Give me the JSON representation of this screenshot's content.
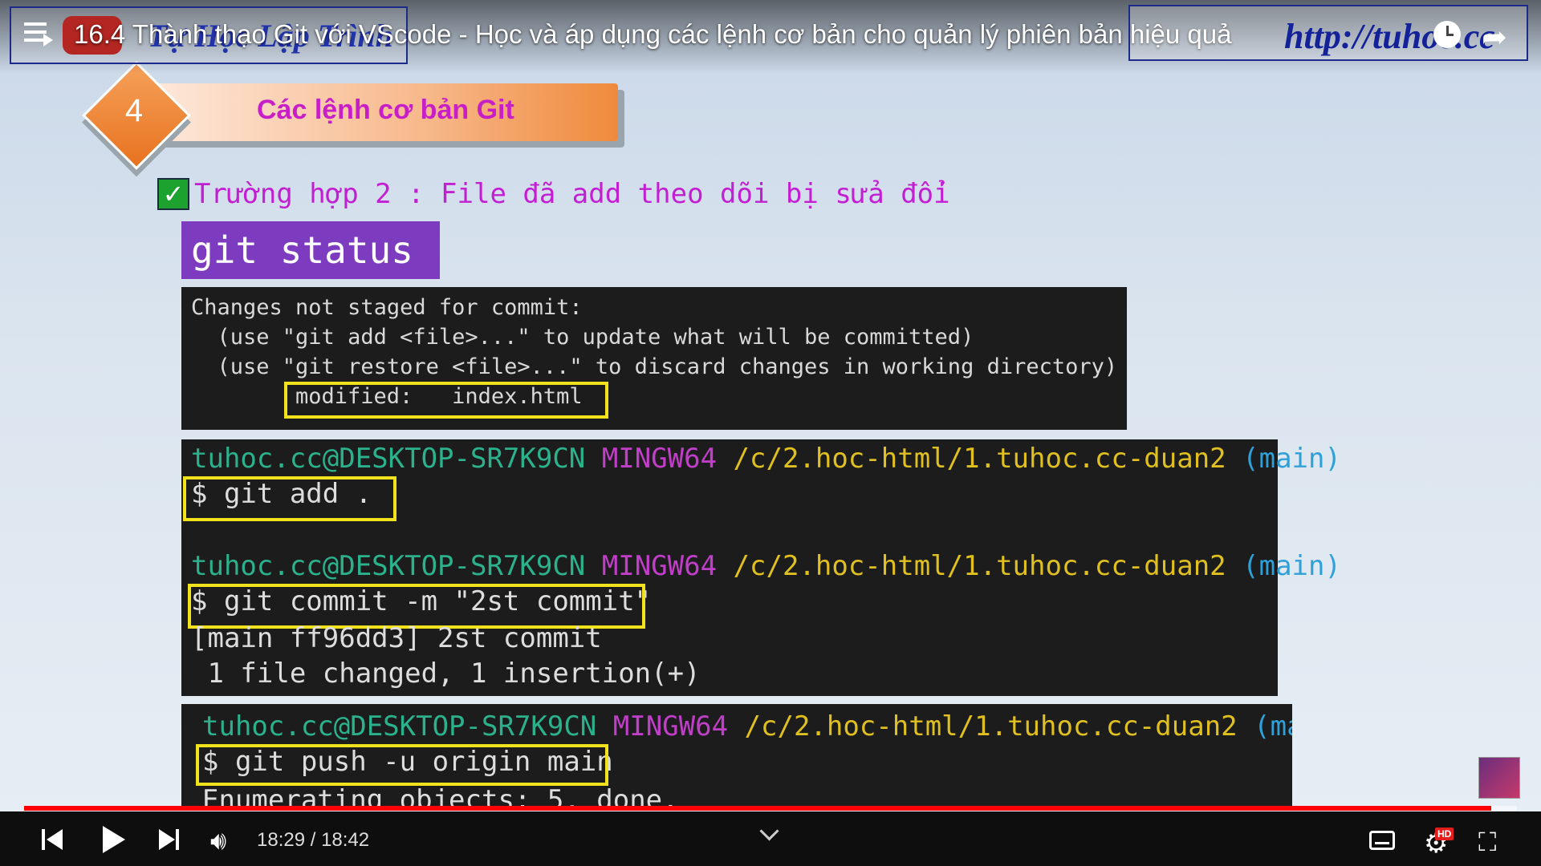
{
  "player": {
    "title": "16.4 Thành thạo Git với VScode - Học và áp dụng các lệnh cơ bản cho quản lý phiên bản hiệu quả",
    "channel_logo_text": "Tự Học Lập Trình",
    "url_overlay": "http://tuhoc.cc",
    "current_time": "18:29",
    "duration": "18:42",
    "time_display": "18:29 / 18:42",
    "progress_fraction": 0.983,
    "hd_badge": "HD"
  },
  "slide": {
    "step_number": "4",
    "header_title": "Các lệnh cơ bản Git",
    "case_line": "Trường hợp 2 : File đã add theo dõi bị sửa đổi",
    "command_label": "git status",
    "status_output": {
      "line1": "Changes not staged for commit:",
      "line2": "  (use \"git add <file>...\" to update what will be committed)",
      "line3": "  (use \"git restore <file>...\" to discard changes in working directory)",
      "modified": "modified:   index.html"
    },
    "prompt": {
      "user": "tuhoc.cc@DESKTOP-SR7K9CN",
      "env": "MINGW64",
      "path": "/c/2.hoc-html/1.tuhoc.cc-duan2",
      "branch": "(main)"
    },
    "cmd_add": "$ git add .",
    "cmd_commit": "$ git commit -m \"2st commit\"",
    "commit_out1": "[main ff96dd3] 2st commit",
    "commit_out2": " 1 file changed, 1 insertion(+)",
    "cmd_push": "$ git push -u origin main",
    "push_out1": "Enumerating objects: 5, done."
  },
  "colors": {
    "accent_magenta": "#c21fd3",
    "command_label_bg": "#7d3bbf",
    "highlight_yellow": "#f2e21c",
    "progress_red": "#ff0000"
  }
}
